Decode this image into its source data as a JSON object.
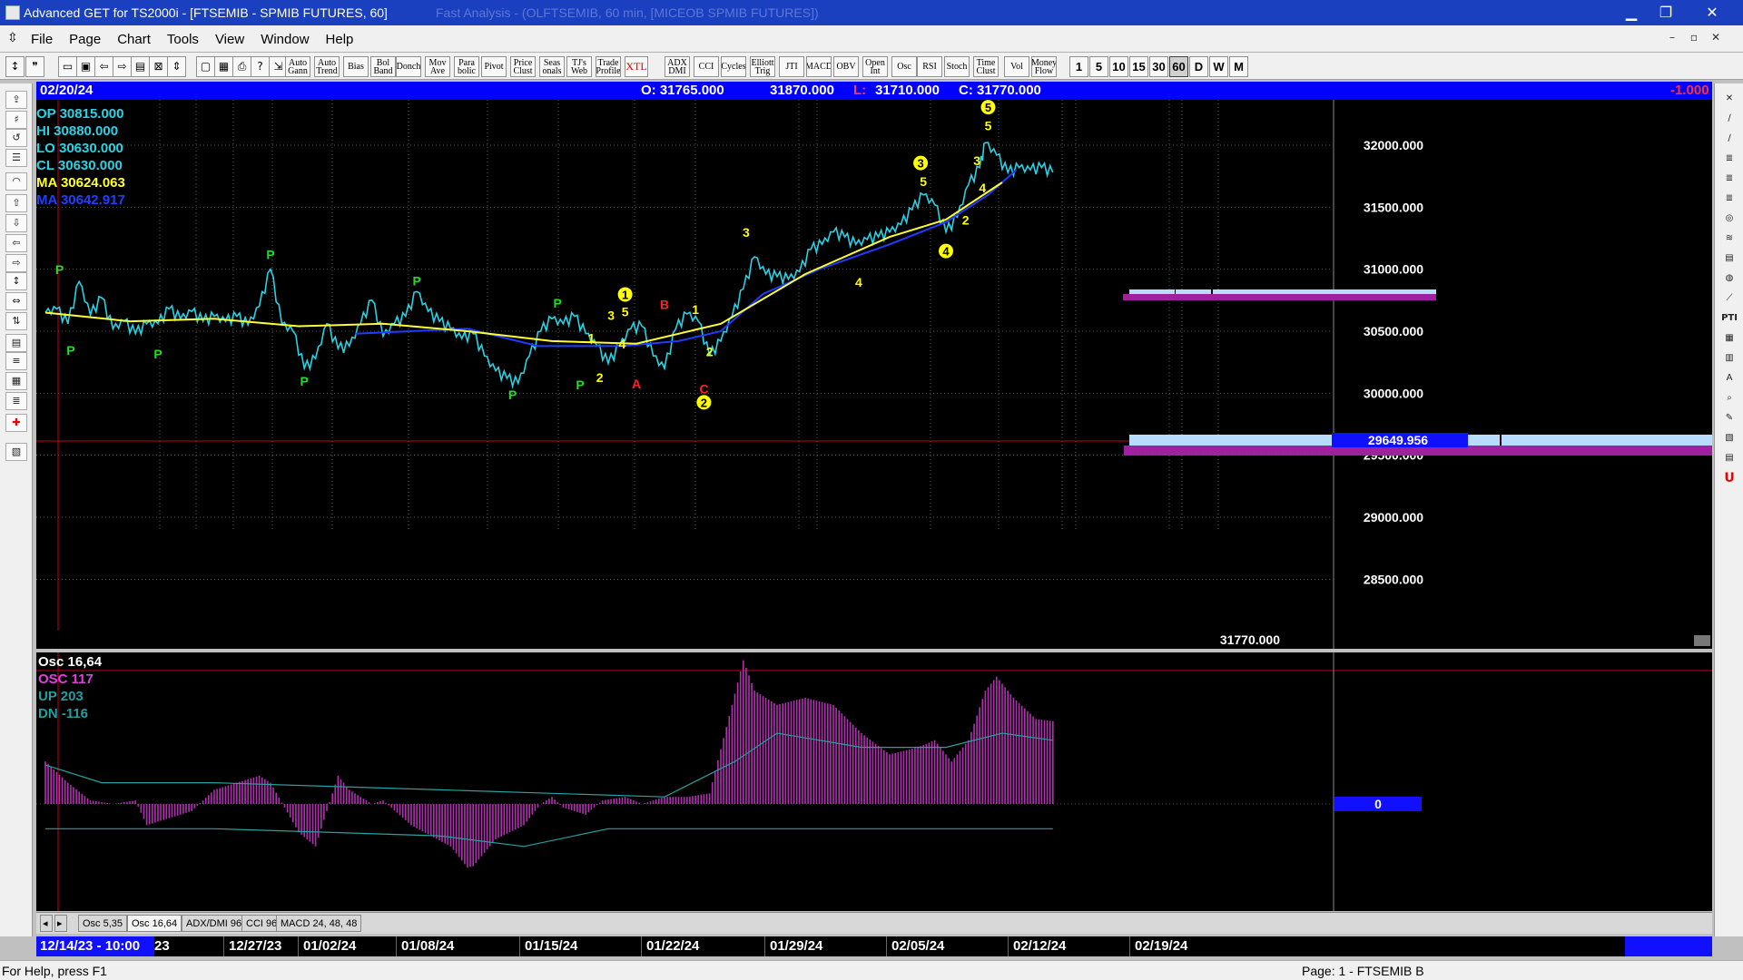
{
  "window": {
    "title": "Advanced GET for TS2000i - [FTSEMIB - SPMIB FUTURES, 60]",
    "ghost_title": "Fast Analysis - (OLFTSEMIB, 60 min, [MICEOB SPMIB FUTURES])",
    "minimize": "▁",
    "maximize": "❐",
    "close": "✕"
  },
  "menu": {
    "items": [
      "File",
      "Page",
      "Chart",
      "Tools",
      "View",
      "Window",
      "Help"
    ],
    "mdi_minimize": "–",
    "mdi_restore": "▫",
    "mdi_close": "✕"
  },
  "toolbar": {
    "study_buttons": [
      "Auto Gann",
      "Auto Trend",
      "Bias",
      "Bol Band",
      "Donch",
      "Mov Ave",
      "Para bolic",
      "Pivot",
      "Price Clust",
      "Seas onals",
      "TJ's Web",
      "Trade Profile",
      "XTL",
      "ADX DMI",
      "CCI",
      "Cycles",
      "Elliott Trig",
      "JTI",
      "MACD",
      "OBV",
      "Open Int",
      "Osc",
      "RSI",
      "Stoch",
      "Time Clust",
      "Vol",
      "Money Flow"
    ],
    "periods": [
      "1",
      "5",
      "10",
      "15",
      "30",
      "60",
      "D",
      "W",
      "M"
    ],
    "active_period": "60"
  },
  "infobar": {
    "date": "02/20/24",
    "open": "O: 31765.000",
    "high": "31870.000",
    "low_prefix": "L:",
    "low": "31710.000",
    "close": "C: 31770.000",
    "change": "-1.000"
  },
  "readout": {
    "op": "OP  30815.000",
    "hi": "HI   30880.000",
    "lo": "LO  30630.000",
    "cl": "CL  30630.000",
    "ma1": "MA  30624.063",
    "ma2": "MA  30642.917"
  },
  "price_axis": {
    "labels": [
      "32000.000",
      "31500.000",
      "31000.000",
      "30500.000",
      "30000.000",
      "29500.000",
      "29000.000",
      "28500.000"
    ],
    "marker": "29649.956",
    "last_value": "31770.000"
  },
  "osc_panel": {
    "title": "Osc 16,64",
    "osc": "OSC 117",
    "up": "UP   203",
    "dn": "DN   -116",
    "zero": "0"
  },
  "tabs": [
    "Osc 5,35",
    "Osc 16,64",
    "ADX/DMI 96",
    "CCI 96",
    "MACD 24, 48, 48"
  ],
  "active_tab": "Osc 16,64",
  "dates": {
    "cursor": "12/14/23 - 10:00",
    "labels": [
      "12/27/23",
      "01/02/24",
      "01/08/24",
      "01/15/24",
      "01/22/24",
      "01/29/24",
      "02/05/24",
      "02/12/24",
      "02/19/24"
    ]
  },
  "status": {
    "help": "For Help, press F1",
    "page": "Page: 1 - FTSEMIB B"
  },
  "colors": {
    "price": "#29d3e6",
    "ma_fast": "#ffff33",
    "ma_slow": "#1f3cff",
    "osc": "#b030b0",
    "pivot": "#22dd22",
    "wave": "#ffff00",
    "abc": "#ff2020"
  },
  "chart_data": {
    "type": "line",
    "price_series": [
      [
        0,
        30650
      ],
      [
        4,
        30680
      ],
      [
        8,
        30560
      ],
      [
        12,
        30900
      ],
      [
        16,
        30630
      ],
      [
        20,
        30770
      ],
      [
        24,
        30520
      ],
      [
        28,
        30580
      ],
      [
        32,
        30480
      ],
      [
        36,
        30560
      ],
      [
        40,
        30560
      ],
      [
        44,
        30680
      ],
      [
        48,
        30600
      ],
      [
        52,
        30660
      ],
      [
        56,
        30580
      ],
      [
        60,
        30620
      ],
      [
        64,
        30580
      ],
      [
        68,
        30620
      ],
      [
        72,
        30550
      ],
      [
        76,
        30700
      ],
      [
        80,
        31000
      ],
      [
        84,
        30560
      ],
      [
        88,
        30500
      ],
      [
        92,
        30200
      ],
      [
        96,
        30280
      ],
      [
        100,
        30560
      ],
      [
        104,
        30360
      ],
      [
        108,
        30380
      ],
      [
        112,
        30560
      ],
      [
        116,
        30750
      ],
      [
        120,
        30460
      ],
      [
        124,
        30560
      ],
      [
        128,
        30620
      ],
      [
        132,
        30820
      ],
      [
        136,
        30660
      ],
      [
        140,
        30580
      ],
      [
        144,
        30520
      ],
      [
        148,
        30440
      ],
      [
        152,
        30480
      ],
      [
        156,
        30300
      ],
      [
        160,
        30180
      ],
      [
        164,
        30120
      ],
      [
        168,
        30080
      ],
      [
        172,
        30300
      ],
      [
        176,
        30500
      ],
      [
        180,
        30600
      ],
      [
        184,
        30560
      ],
      [
        188,
        30620
      ],
      [
        192,
        30480
      ],
      [
        196,
        30380
      ],
      [
        200,
        30240
      ],
      [
        204,
        30380
      ],
      [
        208,
        30520
      ],
      [
        212,
        30540
      ],
      [
        216,
        30300
      ],
      [
        220,
        30200
      ],
      [
        224,
        30520
      ],
      [
        228,
        30640
      ],
      [
        232,
        30580
      ],
      [
        236,
        30300
      ],
      [
        240,
        30420
      ],
      [
        244,
        30620
      ],
      [
        248,
        30840
      ],
      [
        252,
        31100
      ],
      [
        256,
        30960
      ],
      [
        260,
        30940
      ],
      [
        264,
        30920
      ],
      [
        268,
        30980
      ],
      [
        272,
        31160
      ],
      [
        276,
        31200
      ],
      [
        280,
        31300
      ],
      [
        284,
        31260
      ],
      [
        288,
        31200
      ],
      [
        292,
        31240
      ],
      [
        296,
        31260
      ],
      [
        300,
        31300
      ],
      [
        304,
        31360
      ],
      [
        308,
        31480
      ],
      [
        312,
        31600
      ],
      [
        316,
        31520
      ],
      [
        320,
        31300
      ],
      [
        324,
        31420
      ],
      [
        328,
        31680
      ],
      [
        332,
        31820
      ],
      [
        334,
        32020
      ],
      [
        338,
        31920
      ],
      [
        342,
        31780
      ],
      [
        346,
        31820
      ],
      [
        350,
        31800
      ],
      [
        354,
        31820
      ],
      [
        358,
        31780
      ]
    ],
    "ma_fast": [
      [
        0,
        30650
      ],
      [
        30,
        30580
      ],
      [
        60,
        30600
      ],
      [
        90,
        30540
      ],
      [
        120,
        30560
      ],
      [
        150,
        30500
      ],
      [
        180,
        30420
      ],
      [
        210,
        30400
      ],
      [
        240,
        30560
      ],
      [
        270,
        30960
      ],
      [
        300,
        31260
      ],
      [
        320,
        31400
      ],
      [
        340,
        31700
      ]
    ],
    "ma_slow": [
      [
        110,
        30480
      ],
      [
        150,
        30520
      ],
      [
        175,
        30380
      ],
      [
        205,
        30380
      ],
      [
        225,
        30420
      ],
      [
        240,
        30500
      ],
      [
        255,
        30800
      ],
      [
        275,
        31000
      ],
      [
        300,
        31200
      ],
      [
        320,
        31380
      ],
      [
        335,
        31600
      ],
      [
        345,
        31800
      ]
    ],
    "osc_series": [
      [
        0,
        60
      ],
      [
        8,
        30
      ],
      [
        16,
        5
      ],
      [
        24,
        0
      ],
      [
        32,
        5
      ],
      [
        36,
        -30
      ],
      [
        44,
        -20
      ],
      [
        52,
        -10
      ],
      [
        60,
        20
      ],
      [
        68,
        30
      ],
      [
        76,
        40
      ],
      [
        80,
        30
      ],
      [
        90,
        -40
      ],
      [
        96,
        -60
      ],
      [
        100,
        -10
      ],
      [
        104,
        40
      ],
      [
        108,
        20
      ],
      [
        112,
        10
      ],
      [
        116,
        0
      ],
      [
        120,
        5
      ],
      [
        130,
        -30
      ],
      [
        144,
        -60
      ],
      [
        150,
        -90
      ],
      [
        152,
        -88
      ],
      [
        160,
        -50
      ],
      [
        170,
        -30
      ],
      [
        176,
        0
      ],
      [
        180,
        10
      ],
      [
        184,
        -5
      ],
      [
        192,
        -15
      ],
      [
        198,
        5
      ],
      [
        206,
        10
      ],
      [
        212,
        0
      ],
      [
        220,
        10
      ],
      [
        228,
        10
      ],
      [
        236,
        15
      ],
      [
        244,
        140
      ],
      [
        248,
        203
      ],
      [
        252,
        160
      ],
      [
        260,
        140
      ],
      [
        270,
        150
      ],
      [
        280,
        140
      ],
      [
        290,
        100
      ],
      [
        300,
        70
      ],
      [
        310,
        80
      ],
      [
        316,
        90
      ],
      [
        322,
        60
      ],
      [
        328,
        90
      ],
      [
        334,
        160
      ],
      [
        338,
        180
      ],
      [
        344,
        150
      ],
      [
        352,
        120
      ],
      [
        358,
        117
      ]
    ],
    "xlim": [
      0,
      400
    ],
    "ylim": [
      28000,
      32500
    ],
    "osc_ylim": [
      -120,
      210
    ]
  },
  "annotations": [
    {
      "label": "P",
      "color": "pivot",
      "bar": 5,
      "price": 30960
    },
    {
      "label": "P",
      "color": "pivot",
      "bar": 9,
      "price": 30310
    },
    {
      "label": "P",
      "color": "pivot",
      "bar": 40,
      "price": 30280
    },
    {
      "label": "P",
      "color": "pivot",
      "bar": 80,
      "price": 31080
    },
    {
      "label": "P",
      "color": "pivot",
      "bar": 92,
      "price": 30060
    },
    {
      "label": "P",
      "color": "pivot",
      "bar": 132,
      "price": 30870
    },
    {
      "label": "P",
      "color": "pivot",
      "bar": 166,
      "price": 29950
    },
    {
      "label": "P",
      "color": "pivot",
      "bar": 182,
      "price": 30690
    },
    {
      "label": "P",
      "color": "pivot",
      "bar": 190,
      "price": 30030
    },
    {
      "label": "1",
      "color": "wave",
      "bar": 194,
      "price": 30410
    },
    {
      "label": "2",
      "color": "wave",
      "bar": 197,
      "price": 30090
    },
    {
      "label": "3",
      "color": "wave",
      "bar": 201,
      "price": 30590
    },
    {
      "label": "4",
      "color": "wave",
      "bar": 205,
      "price": 30360
    },
    {
      "label": "5",
      "color": "wave",
      "bar": 206,
      "price": 30620
    },
    {
      "label": "A",
      "color": "abc",
      "bar": 210,
      "price": 30040
    },
    {
      "label": "B",
      "color": "abc",
      "bar": 220,
      "price": 30680
    },
    {
      "label": "C",
      "color": "abc",
      "bar": 234,
      "price": 30000
    },
    {
      "label": "1",
      "color": "wave",
      "bar": 231,
      "price": 30640
    },
    {
      "label": "2",
      "color": "wave",
      "bar": 236,
      "price": 30300
    },
    {
      "label": "3",
      "color": "wave",
      "bar": 249,
      "price": 31260
    },
    {
      "label": "4",
      "color": "wave",
      "bar": 289,
      "price": 30860
    },
    {
      "label": "5",
      "color": "wave",
      "bar": 312,
      "price": 31670
    },
    {
      "label": "2",
      "color": "wave",
      "bar": 327,
      "price": 31360
    },
    {
      "label": "3",
      "color": "wave",
      "bar": 331,
      "price": 31840
    },
    {
      "label": "4",
      "color": "wave",
      "bar": 333,
      "price": 31620
    },
    {
      "label": "5",
      "color": "wave",
      "bar": 335,
      "price": 32120
    }
  ],
  "circled": [
    {
      "label": "1",
      "bar": 206,
      "price": 30760
    },
    {
      "label": "2",
      "bar": 234,
      "price": 29890
    },
    {
      "label": "3",
      "bar": 311,
      "price": 31820
    },
    {
      "label": "4",
      "bar": 320,
      "price": 31110
    },
    {
      "label": "5",
      "bar": 335,
      "price": 32270
    }
  ]
}
